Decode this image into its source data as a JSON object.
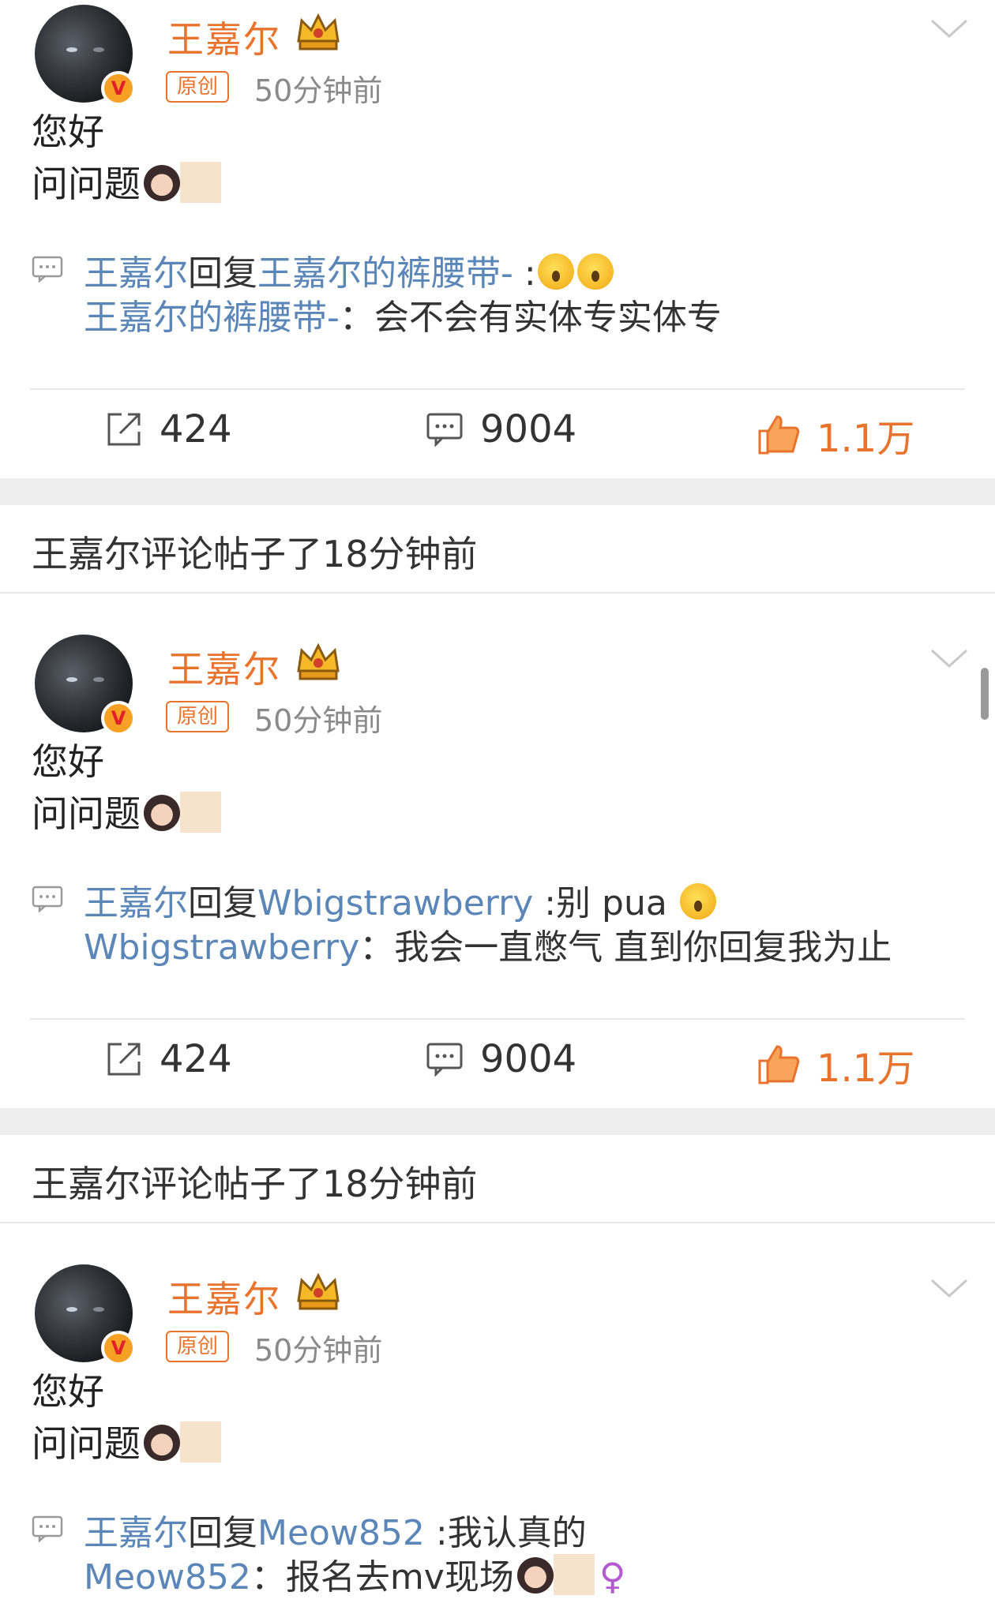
{
  "posts": [
    {
      "username": "王嘉尔",
      "badge": "原创",
      "time": "50分钟前",
      "body_line1": "您好",
      "body_line2": "问问题",
      "reply1_user": "王嘉尔",
      "reply1_mid": "回复",
      "reply1_target": "王嘉尔的裤腰带-",
      "reply1_text": " :",
      "reply2_user": "王嘉尔的裤腰带-",
      "reply2_text": "：会不会有实体专实体专",
      "repost": "424",
      "comments": "9004",
      "likes": "1.1万"
    },
    {
      "username": "王嘉尔",
      "badge": "原创",
      "time": "50分钟前",
      "body_line1": "您好",
      "body_line2": "问问题",
      "reply1_user": "王嘉尔",
      "reply1_mid": "回复",
      "reply1_target": "Wbigstrawberry",
      "reply1_text": " :别 pua ",
      "reply2_user": "Wbigstrawberry",
      "reply2_text": "：我会一直憋气 直到你回复我为止",
      "repost": "424",
      "comments": "9004",
      "likes": "1.1万"
    },
    {
      "username": "王嘉尔",
      "badge": "原创",
      "time": "50分钟前",
      "body_line1": "您好",
      "body_line2": "问问题",
      "reply1_user": "王嘉尔",
      "reply1_mid": "回复",
      "reply1_target": "Meow852",
      "reply1_text": " :我认真的",
      "reply2_user": "Meow852",
      "reply2_text": "：报名去mv现场",
      "repost": "",
      "comments": "",
      "likes": ""
    }
  ],
  "comment_headers": [
    "王嘉尔评论帖子了18分钟前",
    "王嘉尔评论帖子了18分钟前"
  ],
  "colors": {
    "accent_orange": "#e8732c",
    "link_blue": "#5b86b8",
    "separator": "#eeeeee"
  }
}
